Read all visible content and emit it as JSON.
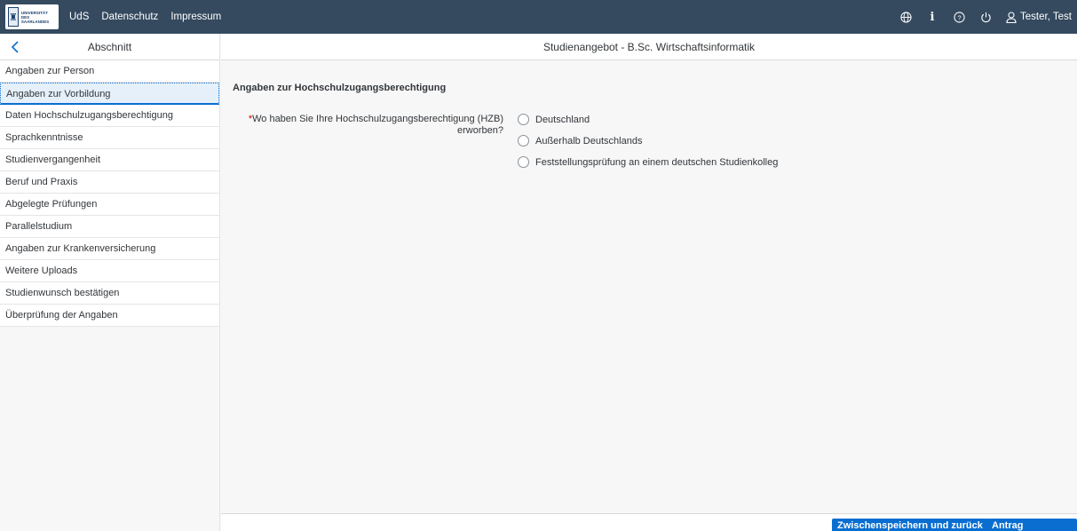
{
  "logo": {
    "text": "UNIVERSITÄT DES SAARLANDES"
  },
  "topnav": {
    "items": [
      "UdS",
      "Datenschutz",
      "Impressum"
    ]
  },
  "topright": {
    "globe_icon": "globe-icon",
    "info_icon": "info-icon",
    "help_icon": "help-icon",
    "power_icon": "power-icon",
    "user_name": "Tester, Test"
  },
  "sidebar": {
    "title": "Abschnitt",
    "items": [
      "Angaben zur Person",
      "Angaben zur Vorbildung",
      "Daten Hochschulzugangsberechtigung",
      "Sprachkenntnisse",
      "Studienvergangenheit",
      "Beruf und Praxis",
      "Abgelegte Prüfungen",
      "Parallelstudium",
      "Angaben zur Krankenversicherung",
      "Weitere Uploads",
      "Studienwunsch bestätigen",
      "Überprüfung der Angaben"
    ]
  },
  "main": {
    "title": "Studienangebot - B.Sc. Wirtschaftsinformatik",
    "section_title": "Angaben zur Hochschulzugangsberechtigung",
    "question": {
      "required_marker": "*",
      "label_line1": "Wo haben Sie Ihre Hochschulzugangsberechtigung (HZB)",
      "label_line2": "erworben?",
      "options": [
        "Deutschland",
        "Außerhalb Deutschlands",
        "Feststellungsprüfung an einem deutschen Studienkolleg"
      ]
    }
  },
  "footer": {
    "save_label": "Zwischenspeichern und zurück",
    "submit_label": "Antrag einreichen"
  }
}
